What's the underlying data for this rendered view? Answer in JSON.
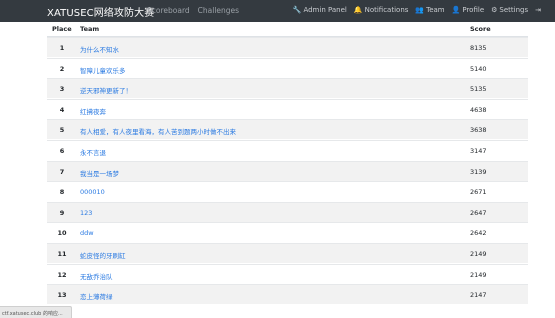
{
  "navbar": {
    "brand": "XATUSEC网络攻防大赛",
    "links": [
      "Scoreboard",
      "Challenges"
    ],
    "right": [
      {
        "icon": "wrench-icon",
        "glyph": "🔧",
        "label": "Admin Panel"
      },
      {
        "icon": "bell-icon",
        "glyph": "🔔",
        "label": "Notifications"
      },
      {
        "icon": "users-icon",
        "glyph": "👥",
        "label": "Team"
      },
      {
        "icon": "user-circle-icon",
        "glyph": "👤",
        "label": "Profile"
      },
      {
        "icon": "gears-icon",
        "glyph": "⚙",
        "label": "Settings"
      },
      {
        "icon": "logout-icon",
        "glyph": "⇥",
        "label": ""
      }
    ]
  },
  "table": {
    "headers": {
      "place": "Place",
      "team": "Team",
      "score": "Score"
    },
    "rows": [
      {
        "place": "1",
        "team": "为什么不知水",
        "score": "8135"
      },
      {
        "place": "2",
        "team": "智障儿童欢乐多",
        "score": "5140"
      },
      {
        "place": "3",
        "team": "逆天邪神更新了！",
        "score": "5135"
      },
      {
        "place": "4",
        "team": "红拂夜奔",
        "score": "4638"
      },
      {
        "place": "5",
        "team": "有人相爱，有人夜里看海，有人苦到题两小时做不出来",
        "score": "3638"
      },
      {
        "place": "6",
        "team": "永不言退",
        "score": "3147"
      },
      {
        "place": "7",
        "team": "我当是一场梦",
        "score": "3139"
      },
      {
        "place": "8",
        "team": "000010",
        "score": "2671"
      },
      {
        "place": "9",
        "team": "123",
        "score": "2647"
      },
      {
        "place": "10",
        "team": "ddw",
        "score": "2642"
      },
      {
        "place": "11",
        "team": "蛇皮怪的牙刷缸",
        "score": "2149"
      },
      {
        "place": "12",
        "team": "无敌乔治队",
        "score": "2149"
      },
      {
        "place": "13",
        "team": "恋上薄荷绿",
        "score": "2147"
      }
    ]
  },
  "statusbar": {
    "text": "ctf.xatusec.club 的响应..."
  }
}
